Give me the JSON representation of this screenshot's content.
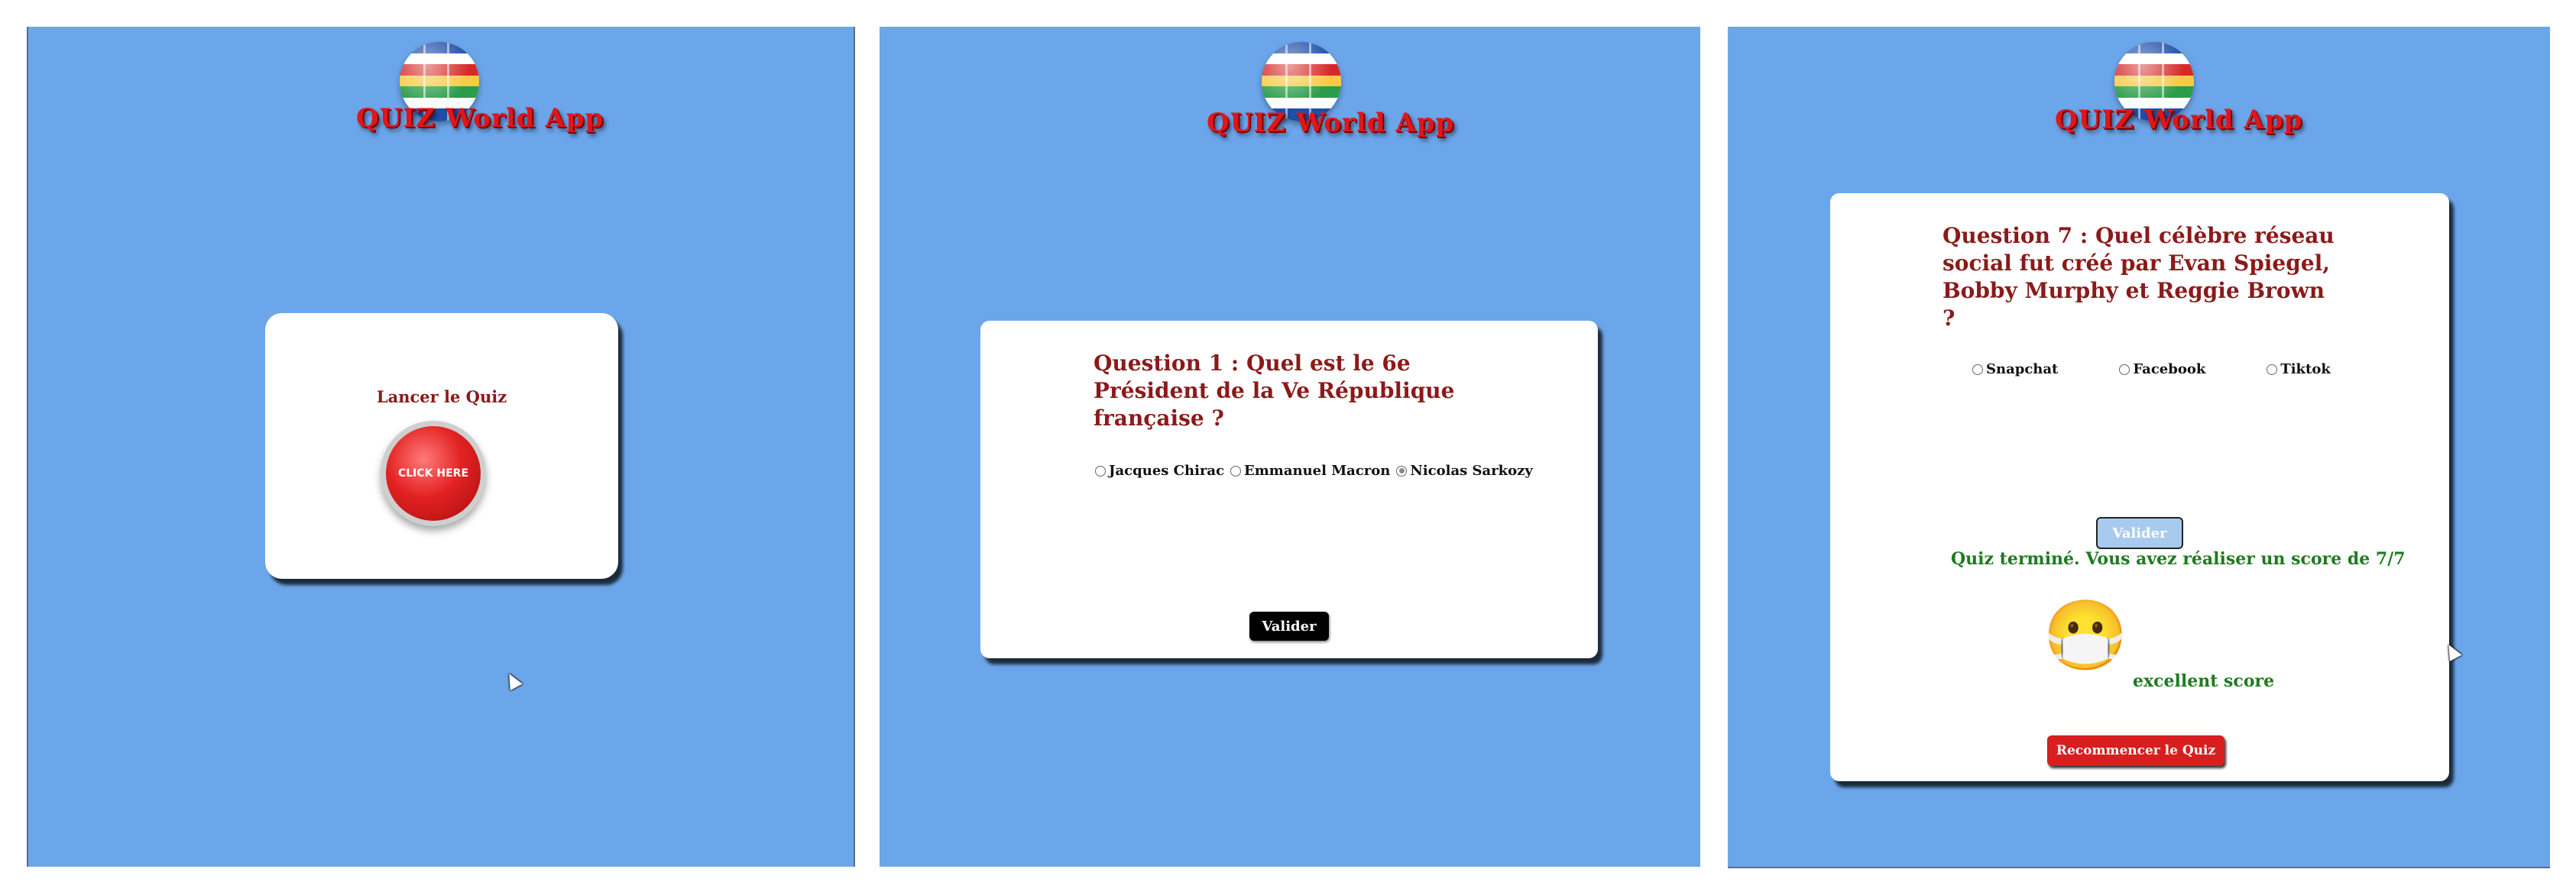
{
  "header": {
    "app_title": "QUIZ World App",
    "logo_icon": "flag-globe-icon"
  },
  "start_screen": {
    "label": "Lancer le Quiz",
    "button_text": "CLICK HERE"
  },
  "question_screen": {
    "question": "Question 1 : Quel est le 6e Président de la Ve République française ?",
    "options": [
      "Jacques Chirac",
      "Emmanuel Macron",
      "Nicolas Sarkozy"
    ],
    "selected_index": 2,
    "submit_label": "Valider"
  },
  "result_screen": {
    "question": "Question 7 : Quel célèbre réseau social fut créé par Evan Spiegel, Bobby Murphy et Reggie Brown ?",
    "options": [
      "Snapchat",
      "Facebook",
      "Tiktok"
    ],
    "submit_label": "Valider",
    "result_message": "Quiz terminé. Vous avez réaliser un score de 7/7",
    "score": "7/7",
    "emoji_icon": "face-with-medical-mask-emoji",
    "emoji": "😷",
    "score_comment": "excellent score",
    "restart_label": "Recommencer le Quiz"
  },
  "colors": {
    "background": "#6ca6ea",
    "title_red": "#e0161b",
    "question_red": "#8b1a1a",
    "success_green": "#1f7a1f",
    "restart_red": "#d81e1e"
  }
}
